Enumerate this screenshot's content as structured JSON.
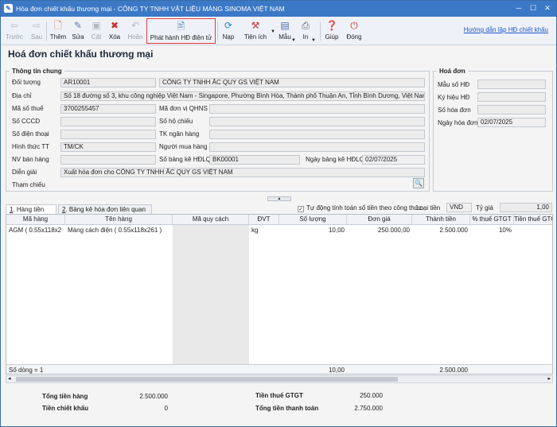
{
  "window": {
    "title": "Hóa đơn chiết khấu thương mại - CÔNG TY TNHH VẬT LIỆU MÀNG SINOMA VIỆT NAM"
  },
  "toolbar": {
    "back": "Trước",
    "next": "Sau",
    "add": "Thêm",
    "edit": "Sửa",
    "save": "Cất",
    "delete": "Xóa",
    "undo": "Hoãn",
    "issue": "Phát hành HĐ điện tử",
    "load": "Nạp",
    "utilities": "Tiện ích",
    "template": "Mẫu",
    "print": "In",
    "help": "Giúp",
    "close": "Đóng",
    "help_link": "Hướng dẫn lập HĐ chiết khấu"
  },
  "page": {
    "title": "Hoá đơn chiết khấu thương mại"
  },
  "general": {
    "section": "Thông tin chung",
    "labels": {
      "object": "Đối tượng",
      "address": "Địa chỉ",
      "tax_code": "Mã số thuế",
      "cccd": "Số CCCD",
      "phone": "Số điện thoại",
      "payment": "Hình thức TT",
      "seller": "NV bán hàng",
      "note": "Diễn giải",
      "reference": "Tham chiếu",
      "unit_code": "Mã đơn vị QHNS",
      "passport": "Số hộ chiếu",
      "bank": "TK ngân hàng",
      "buyer": "Người mua hàng",
      "list_no": "Số bảng kê HĐLQ",
      "list_date": "Ngày bảng kê HĐLQ"
    },
    "object_code": "AR10001",
    "object_name": "CÔNG TY TNHH ẮC QUY GS VIỆT NAM",
    "address": "Số 18 đường số 3, khu công nghiệp Việt Nam - Singapore, Phường Bình Hòa, Thành phố Thuận An, Tỉnh Bình Dương, Việt Nam",
    "tax_code": "3700255457",
    "payment": "TM/CK",
    "list_no": "BK00001",
    "list_date": "02/07/2025",
    "note": "Xuất hóa đơn cho CÔNG TY TNHH ẮC QUY GS VIỆT NAM"
  },
  "invoice": {
    "section": "Hoá đơn",
    "labels": {
      "template": "Mẫu số HĐ",
      "symbol": "Ký hiệu HĐ",
      "number": "Số hóa đơn",
      "date": "Ngày hóa đơn"
    },
    "date": "02/07/2025"
  },
  "tabs": {
    "goods_num": "1",
    "goods": ". Hàng tiền",
    "list_num": "2",
    "list": ". Bảng kê hóa đơn liên quan"
  },
  "options": {
    "auto_calc": "Tự động tính toán số tiền theo công thức",
    "currency_label": "Loại tiền",
    "currency": "VND",
    "rate_label": "Tỷ giá",
    "rate": "1,00"
  },
  "grid": {
    "headers": [
      "Mã hàng",
      "Tên hàng",
      "Mã quy cách",
      "ĐVT",
      "Số lượng",
      "Đơn giá",
      "Thành tiền",
      "% thuế GTGT",
      "Tiền thuế GTGT"
    ],
    "rows": [
      {
        "code": "AGM ( 0.55x118x2",
        "name": "Màng cách điện ( 0.55x118x261 )",
        "spec": "",
        "unit": "kg",
        "qty": "10,00",
        "price": "250.000,00",
        "amount": "2.500.000",
        "vat_rate": "10%",
        "vat": ""
      }
    ],
    "footer": {
      "row_count": "Số dòng = 1",
      "qty_total": "10,00",
      "amount_total": "2.500.000"
    }
  },
  "summary": {
    "goods_label": "Tổng tiền hàng",
    "goods": "2.500.000",
    "discount_label": "Tiền chiết khấu",
    "discount": "0",
    "vat_label": "Tiền thuế GTGT",
    "vat": "250.000",
    "total_label": "Tổng tiền thanh toán",
    "total": "2.750.000"
  }
}
